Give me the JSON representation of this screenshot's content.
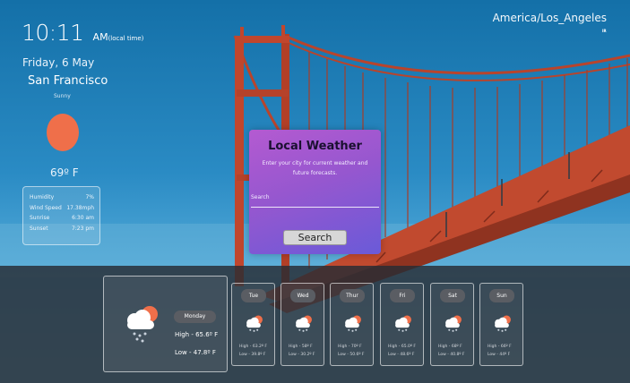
{
  "clock": {
    "time": "10:11",
    "ampm": "AM",
    "ampm_note": "(local time)"
  },
  "location": {
    "date": "Friday, 6 May",
    "city": "San Francisco",
    "condition": "Sunny",
    "temperature": "69º F"
  },
  "details": [
    {
      "label": "Humidity",
      "value": "7%"
    },
    {
      "label": "Wind Speed",
      "value": "17.38mph"
    },
    {
      "label": "Sunrise",
      "value": "6:30 am"
    },
    {
      "label": "Sunset",
      "value": "7:23 pm"
    }
  ],
  "timezone": {
    "name": "America/Los_Angeles",
    "mark": "IR"
  },
  "search_card": {
    "title": "Local Weather",
    "description": "Enter your city for current weather and future forecasts.",
    "search_label": "Search",
    "button_label": "Search"
  },
  "today": {
    "day": "Monday",
    "high": "High - 65.6º F",
    "low": "Low - 47.8º F"
  },
  "forecast": [
    {
      "day": "Tue",
      "high": "High - 63.2º F",
      "low": "Low - 39.8º F"
    },
    {
      "day": "Wed",
      "high": "High - 58º F",
      "low": "Low - 30.2º F"
    },
    {
      "day": "Thur",
      "high": "High - 70º F",
      "low": "Low - 50.6º F"
    },
    {
      "day": "Fri",
      "high": "High - 65.0º F",
      "low": "Low - 48.6º F"
    },
    {
      "day": "Sat",
      "high": "High - 68º F",
      "low": "Low - 40.8º F"
    },
    {
      "day": "Sun",
      "high": "High - 66º F",
      "low": "Low - 44º F"
    }
  ],
  "icons": {
    "weather": "cloud-sun-rain-icon",
    "sun": "sun-icon"
  },
  "colors": {
    "sun": "#ef6f4a",
    "card_gradient_start": "#b45ad1",
    "card_gradient_end": "#6a5ad8",
    "bridge": "#b8442c"
  }
}
